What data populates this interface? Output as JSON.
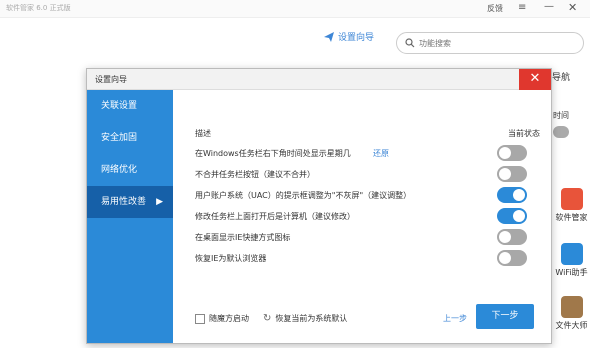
{
  "background": {
    "title": "软件管家 6.0 正式版",
    "feedback": "反馈",
    "menu_icon": "≡",
    "min_icon": "—",
    "close_icon": "✕",
    "wizard_label": "设置向导",
    "search_placeholder": "功能搜索",
    "right_label_1": "导航",
    "right_label_2": "时间",
    "apps": [
      {
        "label": "软件管家",
        "color": "#e8543a"
      },
      {
        "label": "WiFi助手",
        "color": "#2b8ad8"
      },
      {
        "label": "文件大师",
        "color": "#a0784a"
      }
    ]
  },
  "dialog": {
    "title": "设置向导",
    "close_icon": "✕",
    "nav": [
      {
        "label": "关联设置",
        "active": false
      },
      {
        "label": "安全加固",
        "active": false
      },
      {
        "label": "网络优化",
        "active": false
      },
      {
        "label": "易用性改善",
        "active": true
      }
    ],
    "nav_arrow": "▶",
    "header_desc": "描述",
    "header_state": "当前状态",
    "options": [
      {
        "label": "在Windows任务栏右下角时间处显示星期几",
        "link": "还原",
        "on": false
      },
      {
        "label": "不合并任务栏按钮（建议不合并）",
        "link": "",
        "on": false
      },
      {
        "label": "用户账户系统（UAC）的提示框调整为\"不灰屏\"（建议调整）",
        "link": "",
        "on": true
      },
      {
        "label": "修改任务栏上面打开后是计算机（建议修改）",
        "link": "",
        "on": true
      },
      {
        "label": "在桌面显示IE快捷方式图标",
        "link": "",
        "on": false
      },
      {
        "label": "恢复IE为默认浏览器",
        "link": "",
        "on": false
      }
    ],
    "footer": {
      "checkbox_label": "随魔方启动",
      "restore_icon": "↻",
      "restore_label": "恢复当前为系统默认",
      "prev_label": "上一步",
      "next_label": "下一步"
    },
    "colors": {
      "accent": "#2b8ad8",
      "sidebar_active": "#1660a8",
      "close_red": "#e0372e"
    }
  }
}
